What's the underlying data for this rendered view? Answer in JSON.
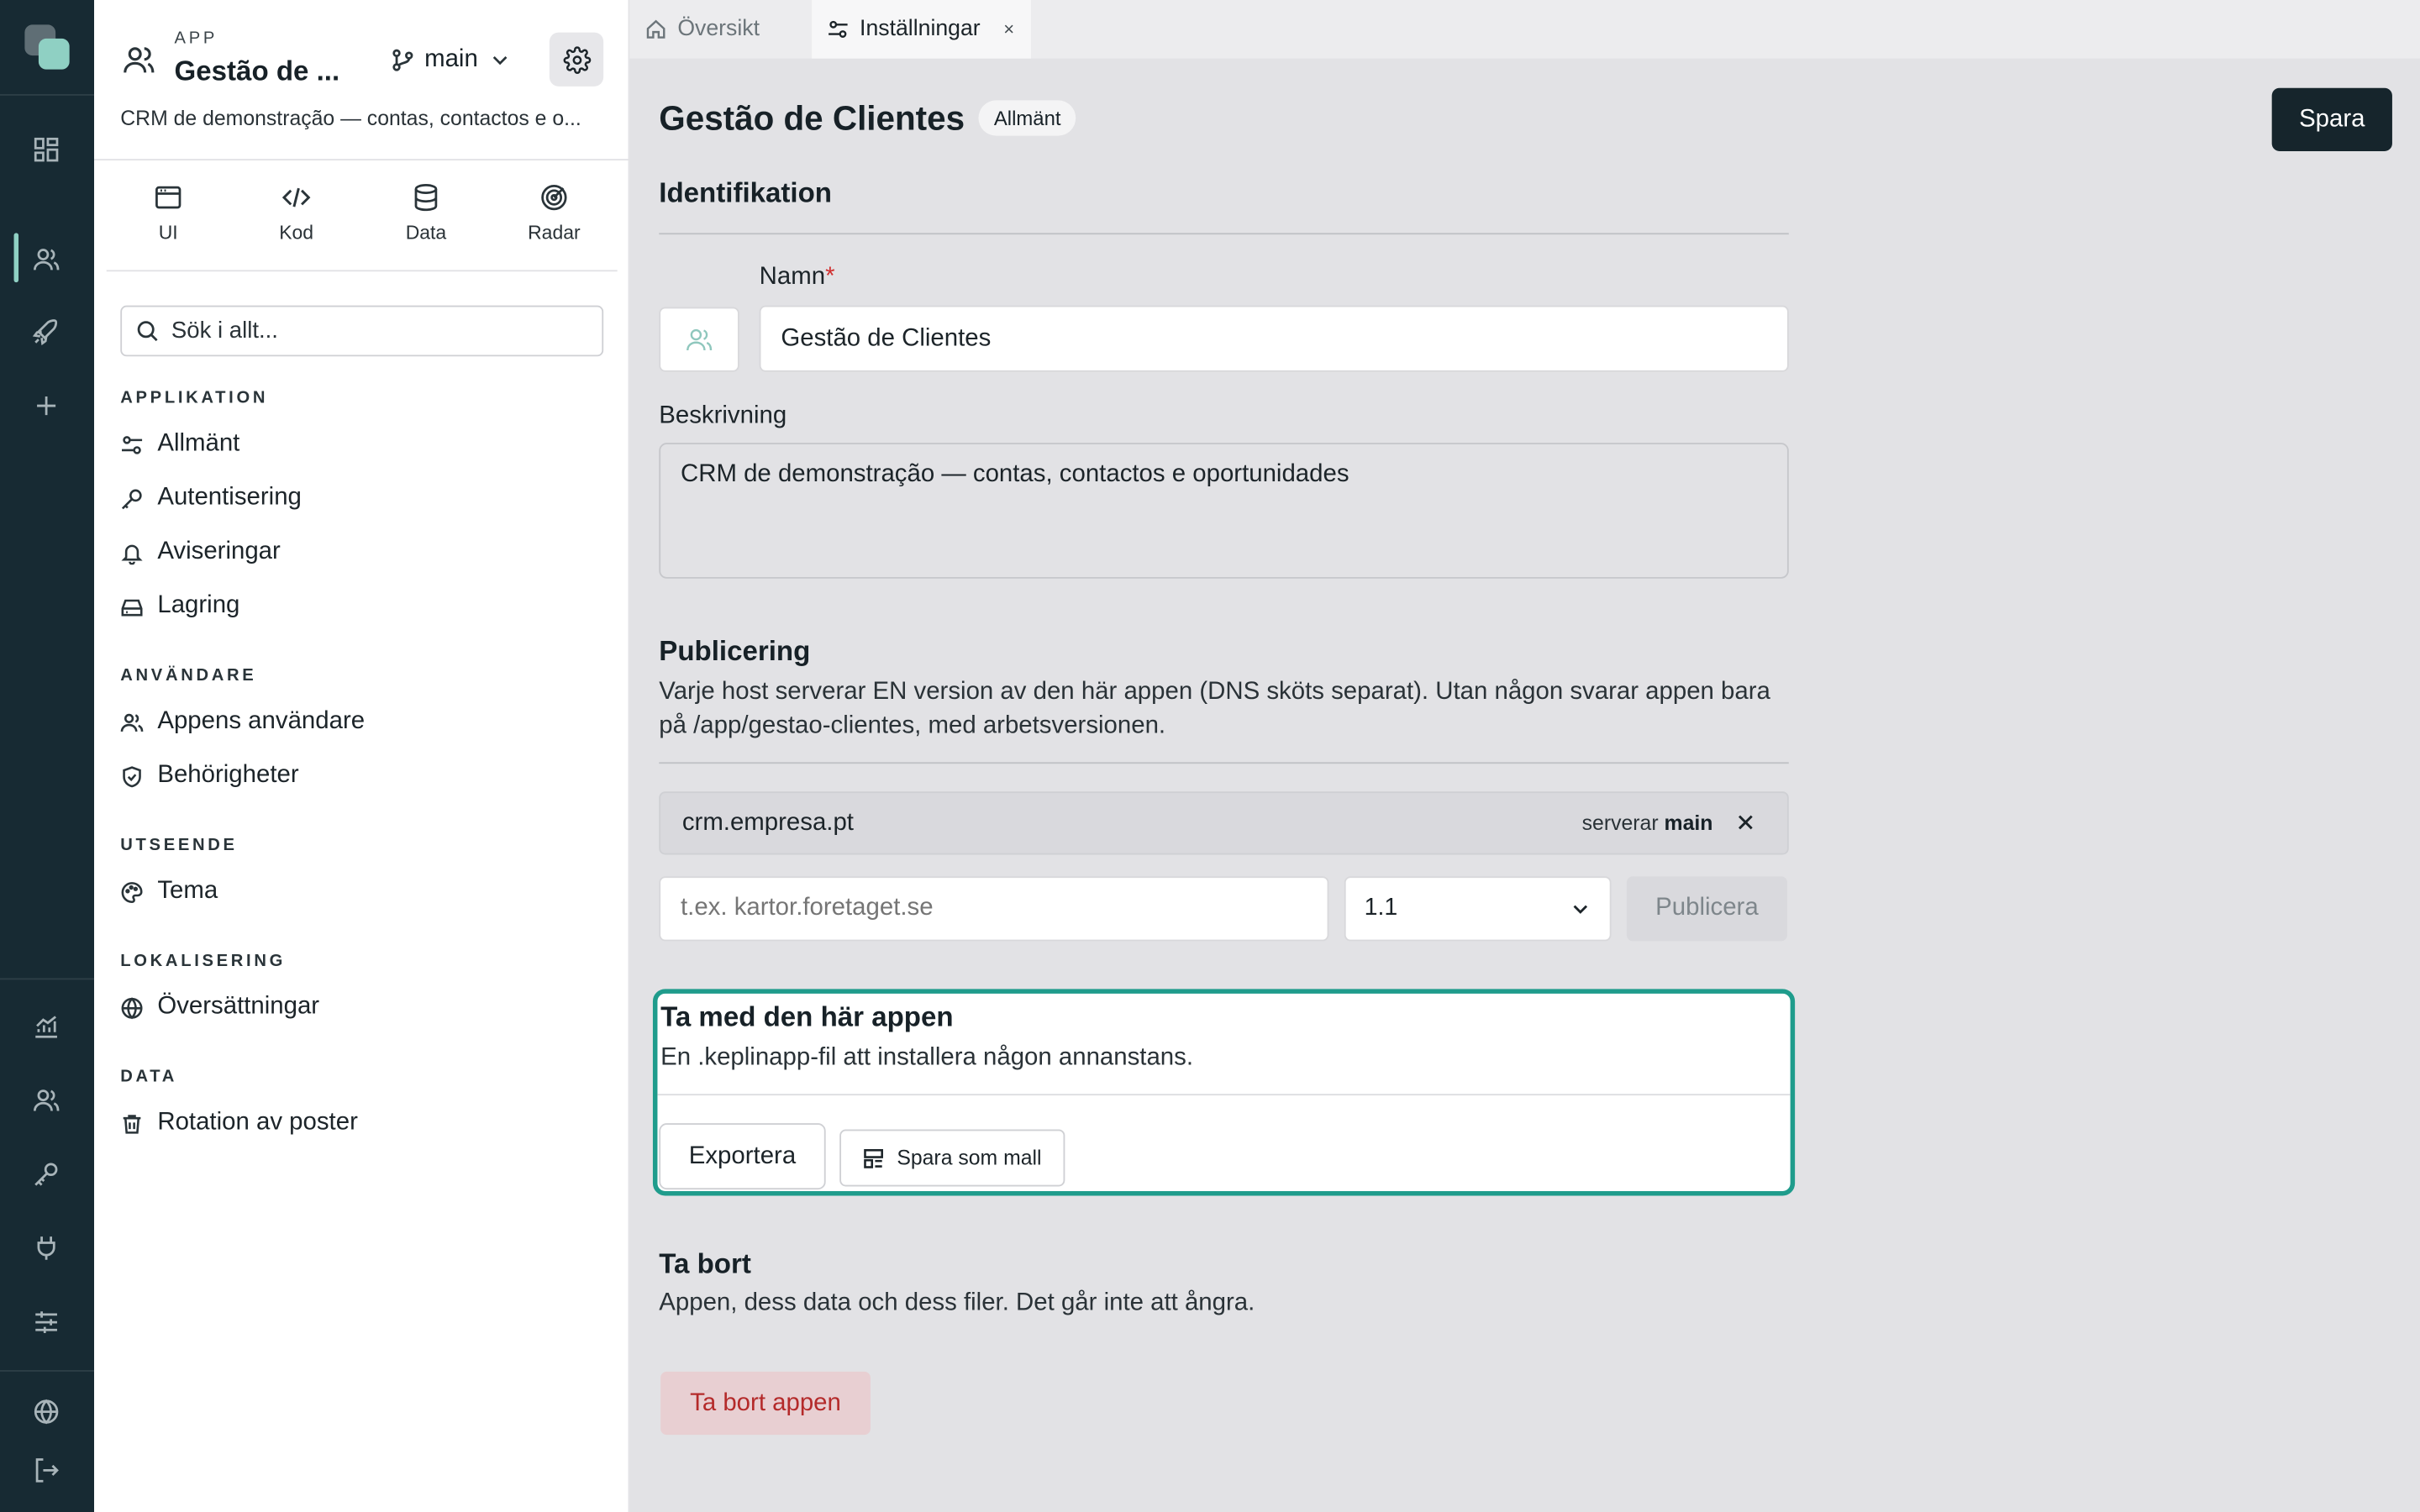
{
  "tabs": [
    {
      "label": "Översikt",
      "icon": "home-icon"
    },
    {
      "label": "Inställningar",
      "icon": "settings-sliders-icon",
      "close": "×"
    }
  ],
  "app": {
    "eyebrow": "APP",
    "title": "Gestão de ...",
    "branch": "main",
    "description": "CRM de demonstração — contas, contactos e o..."
  },
  "tools": [
    {
      "label": "UI",
      "icon": "browser-window-icon"
    },
    {
      "label": "Kod",
      "icon": "code-icon"
    },
    {
      "label": "Data",
      "icon": "database-icon"
    },
    {
      "label": "Radar",
      "icon": "radar-icon"
    }
  ],
  "search": {
    "placeholder": "Sök i allt..."
  },
  "sections": [
    {
      "title": "APPLIKATION",
      "items": [
        {
          "label": "Allmänt",
          "icon": "sliders-icon"
        },
        {
          "label": "Autentisering",
          "icon": "key-icon"
        },
        {
          "label": "Aviseringar",
          "icon": "bell-icon"
        },
        {
          "label": "Lagring",
          "icon": "storage-icon"
        }
      ]
    },
    {
      "title": "ANVÄNDARE",
      "items": [
        {
          "label": "Appens användare",
          "icon": "users-icon"
        },
        {
          "label": "Behörigheter",
          "icon": "shield-check-icon"
        }
      ]
    },
    {
      "title": "UTSEENDE",
      "items": [
        {
          "label": "Tema",
          "icon": "palette-icon"
        }
      ]
    },
    {
      "title": "LOKALISERING",
      "items": [
        {
          "label": "Översättningar",
          "icon": "globe-icon"
        }
      ]
    },
    {
      "title": "DATA",
      "items": [
        {
          "label": "Rotation av poster",
          "icon": "trash-icon"
        }
      ]
    }
  ],
  "main": {
    "title": "Gestão de Clientes",
    "badge": "Allmänt",
    "save": "Spara",
    "identification": {
      "heading": "Identifikation",
      "name_label": "Namn",
      "required_mark": "*",
      "name_value": "Gestão de Clientes",
      "desc_label": "Beskrivning",
      "desc_value": "CRM de demonstração — contas, contactos e oportunidades"
    },
    "publishing": {
      "heading": "Publicering",
      "description": "Varje host serverar EN version av den här appen (DNS sköts separat). Utan någon svarar appen bara på /app/gestao-clientes, med arbetsversionen.",
      "host": "crm.empresa.pt",
      "serves_prefix": "serverar",
      "serves_branch": "main",
      "host_placeholder": "t.ex. kartor.foretaget.se",
      "version": "1.1",
      "publish": "Publicera"
    },
    "take_along": {
      "heading": "Ta med den här appen",
      "description": "En .keplinapp-fil att installera någon annanstans.",
      "export": "Exportera",
      "save_template": "Spara som mall"
    },
    "delete": {
      "heading": "Ta bort",
      "description": "Appen, dess data och dess filer. Det går inte att ångra.",
      "button": "Ta bort appen"
    }
  }
}
